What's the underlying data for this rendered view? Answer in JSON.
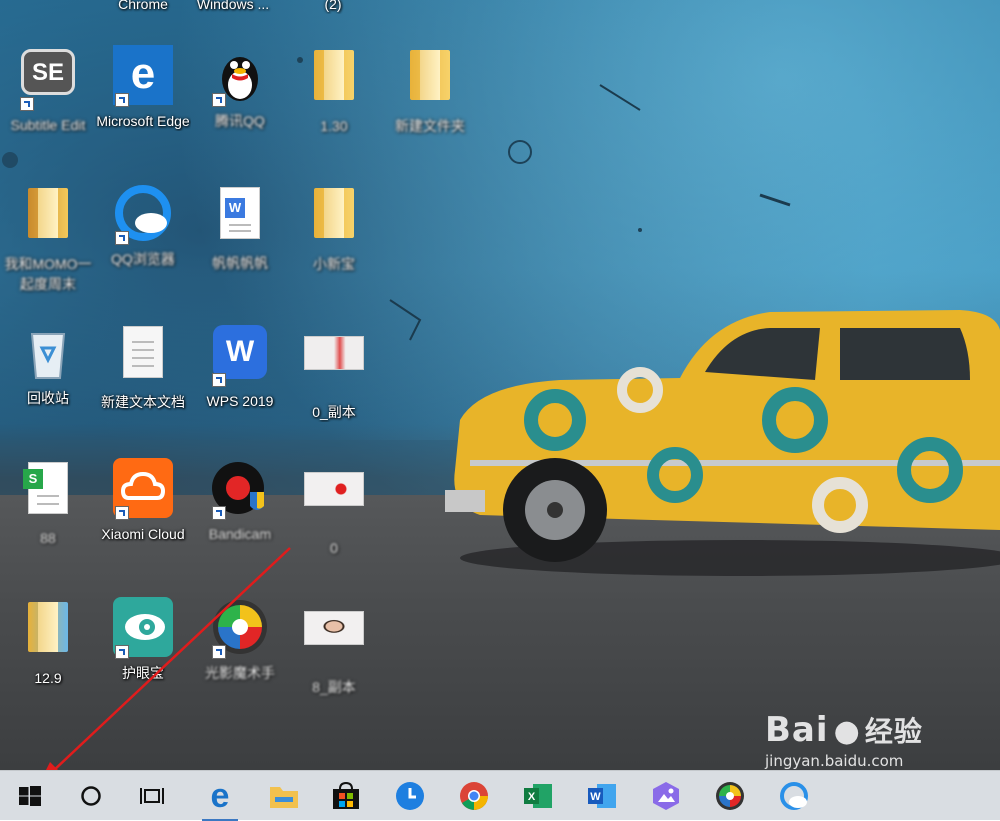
{
  "desktop": {
    "top_labels": [
      "Chrome",
      "Windows ...",
      "(2)"
    ],
    "icons": [
      {
        "label": "Subtitle Edit",
        "type": "se",
        "shortcut": true,
        "blur": true
      },
      {
        "label": "Microsoft Edge",
        "type": "edge",
        "shortcut": true,
        "blur": true
      },
      {
        "label": "腾讯QQ",
        "type": "qq",
        "shortcut": true,
        "blur": true
      },
      {
        "label": "1.30",
        "type": "folder",
        "shortcut": false,
        "blur": true
      },
      {
        "label": "新建文件夹",
        "type": "folder",
        "shortcut": false,
        "blur": true
      },
      {
        "label": "我和MOMO一起度周末",
        "type": "folder-photo",
        "shortcut": false,
        "blur": true
      },
      {
        "label": "QQ浏览器",
        "type": "qqbrowser",
        "shortcut": true,
        "blur": true
      },
      {
        "label": "帆帆帆帆",
        "type": "wps-doc",
        "shortcut": false,
        "blur": true
      },
      {
        "label": "小新宝",
        "type": "folder",
        "shortcut": false,
        "blur": true
      },
      {
        "label": "回收站",
        "type": "recycle",
        "shortcut": false,
        "blur": false
      },
      {
        "label": "新建文本文档",
        "type": "textdoc",
        "shortcut": false,
        "blur": false
      },
      {
        "label": "WPS 2019",
        "type": "wps",
        "shortcut": true,
        "blur": false
      },
      {
        "label": "0_副本",
        "type": "thumb",
        "shortcut": false,
        "blur": false
      },
      {
        "label": "88",
        "type": "sheet",
        "shortcut": false,
        "blur": true
      },
      {
        "label": "Xiaomi Cloud",
        "type": "micloud",
        "shortcut": true,
        "blur": true
      },
      {
        "label": "Bandicam",
        "type": "bandicam",
        "shortcut": true,
        "blur": true
      },
      {
        "label": "0",
        "type": "thumb",
        "shortcut": false,
        "blur": true
      },
      {
        "label": "12.9",
        "type": "folder-blue",
        "shortcut": false,
        "blur": false
      },
      {
        "label": "护眼宝",
        "type": "eye",
        "shortcut": true,
        "blur": false
      },
      {
        "label": "光影魔术手",
        "type": "aperture",
        "shortcut": true,
        "blur": true
      },
      {
        "label": "8_副本",
        "type": "thumb-person",
        "shortcut": false,
        "blur": true
      }
    ]
  },
  "taskbar": {
    "items": [
      "start-windows",
      "cortana-search",
      "task-view",
      "edge",
      "file-explorer",
      "store",
      "clock-app",
      "chrome",
      "excel",
      "word",
      "photos",
      "aperture-app",
      "cloud-app"
    ]
  },
  "watermark": {
    "brand": "Bai",
    "brand_cn": "经验",
    "site": "jingyan.baidu.com"
  },
  "colors": {
    "taskbar": "#d9dde2",
    "car": "#e8b429",
    "arrow": "#e01c1c"
  }
}
